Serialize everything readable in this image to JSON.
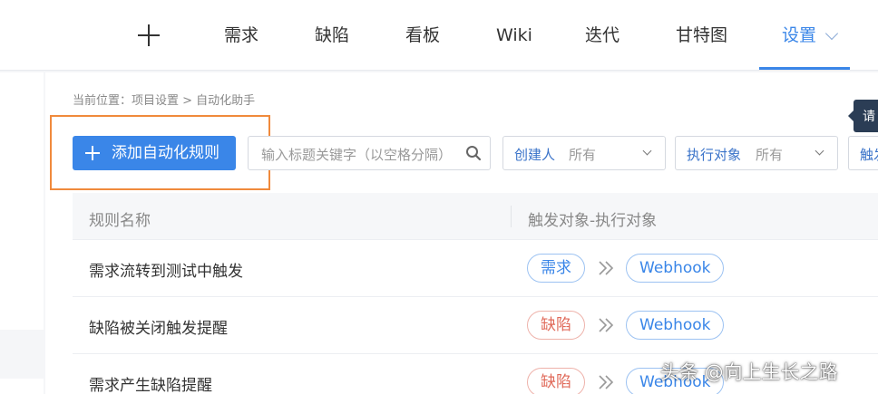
{
  "nav": {
    "items": [
      {
        "label": "需求"
      },
      {
        "label": "缺陷"
      },
      {
        "label": "看板"
      },
      {
        "label": "Wiki"
      },
      {
        "label": "迭代"
      },
      {
        "label": "甘特图"
      },
      {
        "label": "设置",
        "active": true
      }
    ],
    "icons": {
      "add": "plus-icon",
      "dropdown": "chevron-down-icon"
    }
  },
  "breadcrumb": "当前位置：项目设置 > 自动化助手",
  "toolbar": {
    "add_button": "添加自动化规则",
    "search_placeholder": "输入标题关键字（以空格分隔）",
    "filters": [
      {
        "label": "创建人",
        "value": "所有"
      },
      {
        "label": "执行对象",
        "value": "所有"
      },
      {
        "label": "触发"
      }
    ]
  },
  "tooltip": "请",
  "table": {
    "headers": [
      "规则名称",
      "触发对象-执行对象"
    ],
    "rows": [
      {
        "name": "需求流转到测试中触发",
        "trigger": "需求",
        "trigger_color": "#3a86e8",
        "target": "Webhook"
      },
      {
        "name": "缺陷被关闭触发提醒",
        "trigger": "缺陷",
        "trigger_color": "#e06a5a",
        "target": "Webhook"
      },
      {
        "name": "需求产生缺陷提醒",
        "trigger": "缺陷",
        "trigger_color": "#e06a5a",
        "target": "Webhook"
      }
    ]
  },
  "watermark": "头条 @向上生长之路",
  "colors": {
    "accent": "#3a86e8",
    "highlight_box": "#f08a3c"
  }
}
